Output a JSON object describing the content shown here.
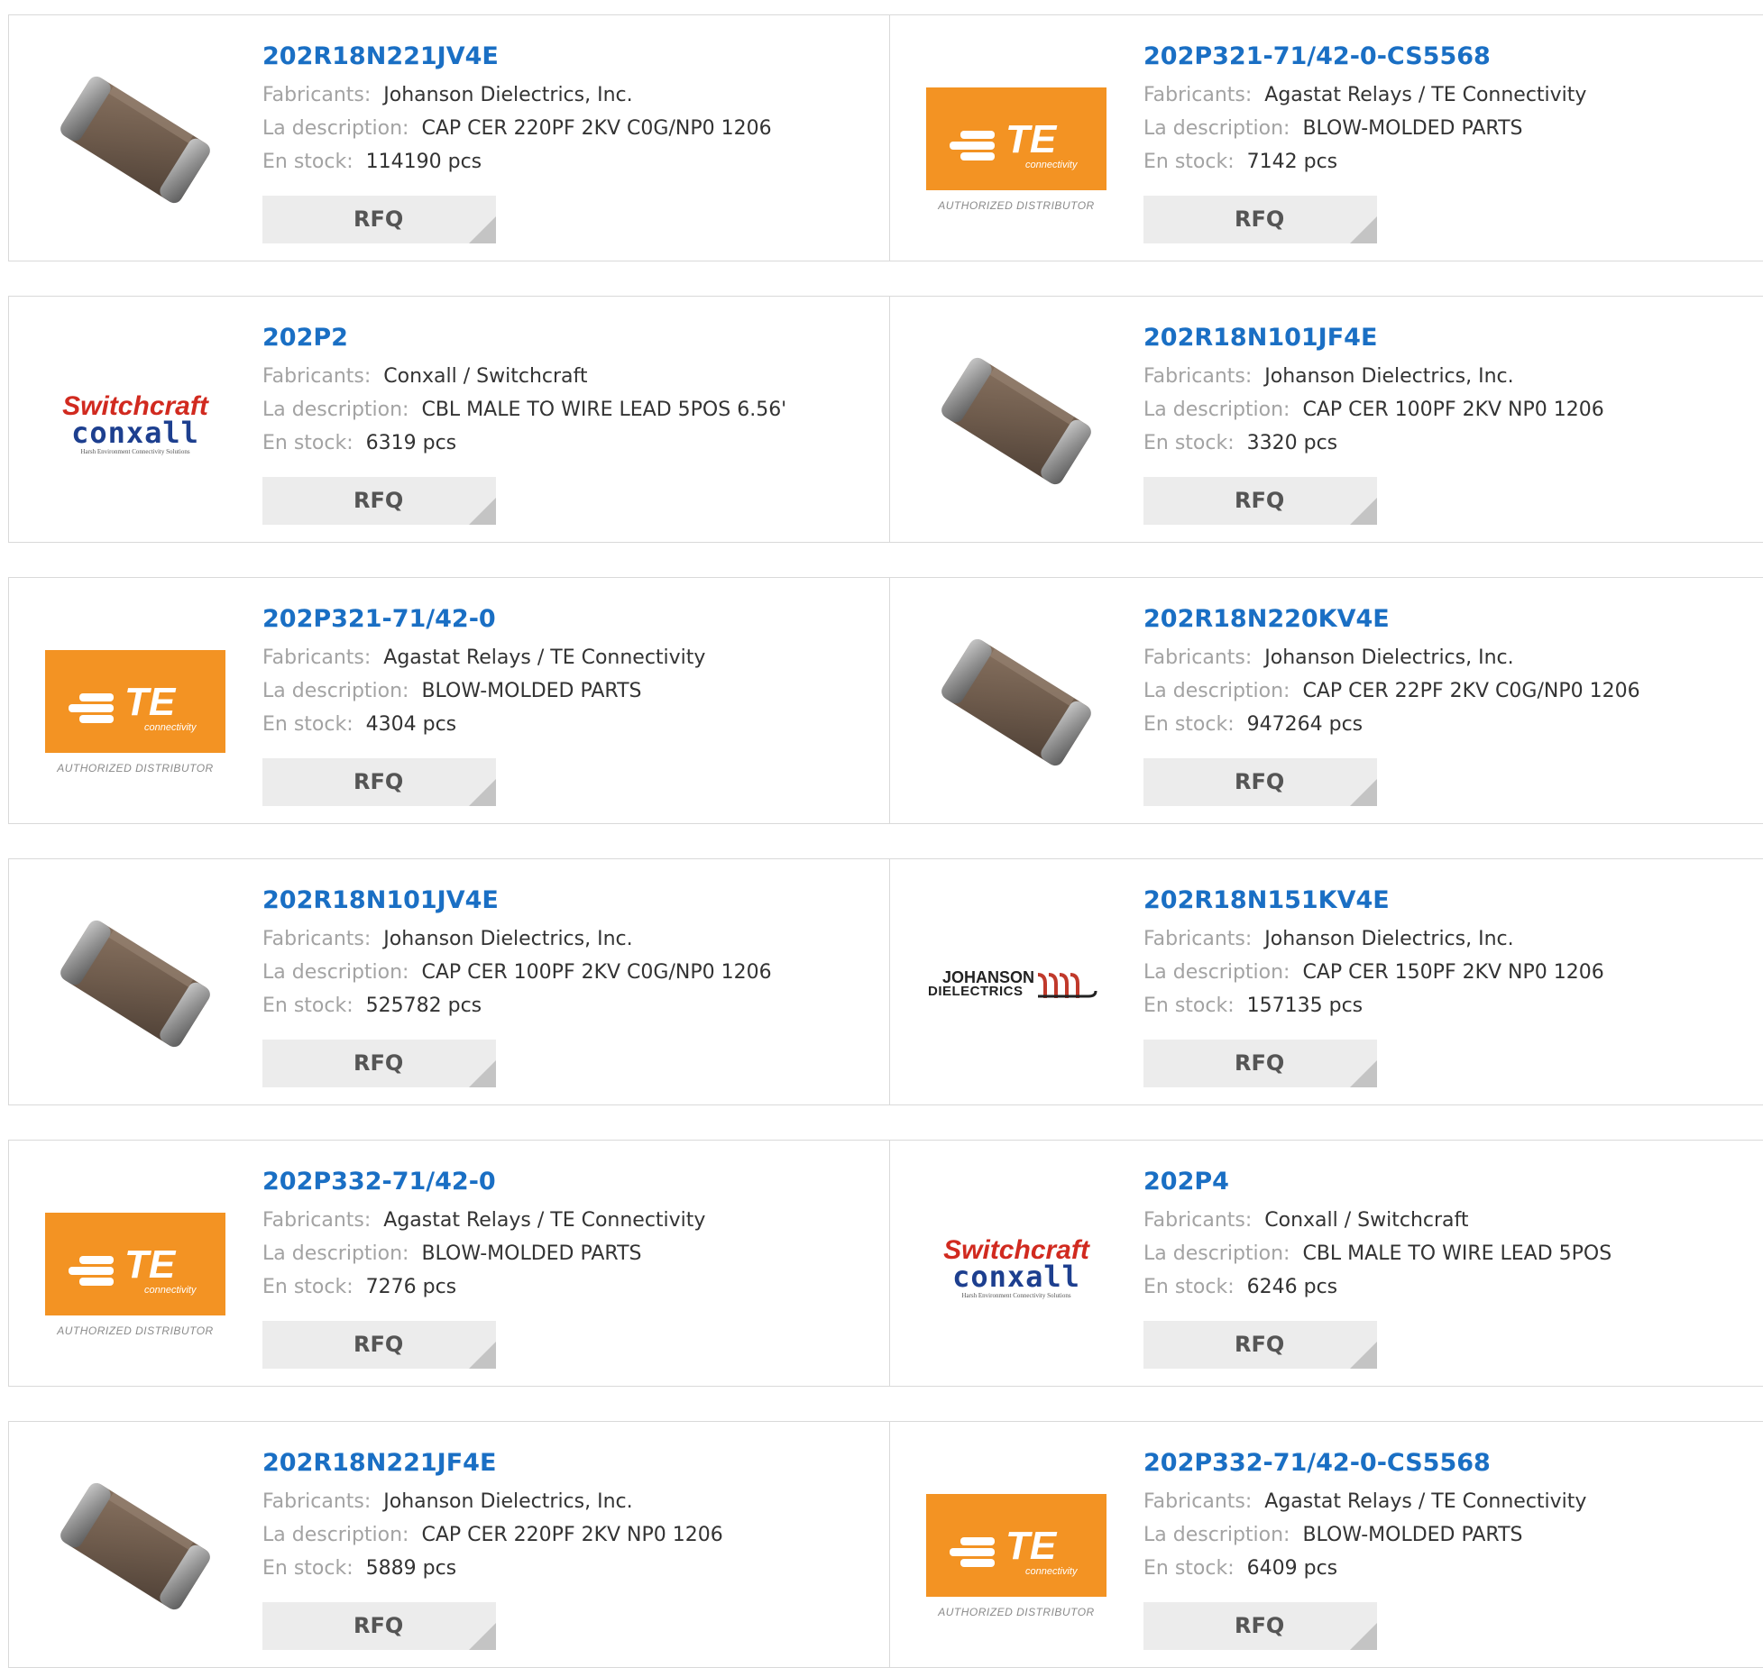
{
  "labels": {
    "manufacturer": "Fabricants:",
    "description": "La description:",
    "stock": "En stock:",
    "rfq": "RFQ",
    "te_authorized": "AUTHORIZED DISTRIBUTOR",
    "te_logo": "TE",
    "te_sub": "connectivity",
    "sw_top": "Switchcraft",
    "sw_bottom": "conxall",
    "sw_tag": "Harsh Environment Connectivity Solutions",
    "jo_top": "JOHANSON",
    "jo_bottom": "DIELECTRICS"
  },
  "colors": {
    "link": "#1a6fc4",
    "te_orange": "#f39323",
    "sw_red": "#d12a1f",
    "cx_blue": "#1d3f8f"
  },
  "rows": [
    [
      {
        "part": "202R18N221JV4E",
        "manufacturer": "Johanson Dielectrics, Inc.",
        "description": "CAP CER 220PF 2KV C0G/NP0 1206",
        "stock": "114190 pcs",
        "image": "chip-capacitor"
      },
      {
        "part": "202P321-71/42-0-CS5568",
        "manufacturer": "Agastat Relays / TE Connectivity",
        "description": "BLOW-MOLDED PARTS",
        "stock": "7142 pcs",
        "image": "te-logo"
      }
    ],
    [
      {
        "part": "202P2",
        "manufacturer": "Conxall / Switchcraft",
        "description": "CBL MALE TO WIRE LEAD 5POS 6.56'",
        "stock": "6319 pcs",
        "image": "switchcraft-logo"
      },
      {
        "part": "202R18N101JF4E",
        "manufacturer": "Johanson Dielectrics, Inc.",
        "description": "CAP CER 100PF 2KV NP0 1206",
        "stock": "3320 pcs",
        "image": "chip-capacitor"
      }
    ],
    [
      {
        "part": "202P321-71/42-0",
        "manufacturer": "Agastat Relays / TE Connectivity",
        "description": "BLOW-MOLDED PARTS",
        "stock": "4304 pcs",
        "image": "te-logo"
      },
      {
        "part": "202R18N220KV4E",
        "manufacturer": "Johanson Dielectrics, Inc.",
        "description": "CAP CER 22PF 2KV C0G/NP0 1206",
        "stock": "947264 pcs",
        "image": "chip-capacitor"
      }
    ],
    [
      {
        "part": "202R18N101JV4E",
        "manufacturer": "Johanson Dielectrics, Inc.",
        "description": "CAP CER 100PF 2KV C0G/NP0 1206",
        "stock": "525782 pcs",
        "image": "chip-capacitor"
      },
      {
        "part": "202R18N151KV4E",
        "manufacturer": "Johanson Dielectrics, Inc.",
        "description": "CAP CER 150PF 2KV NP0 1206",
        "stock": "157135 pcs",
        "image": "johanson-logo"
      }
    ],
    [
      {
        "part": "202P332-71/42-0",
        "manufacturer": "Agastat Relays / TE Connectivity",
        "description": "BLOW-MOLDED PARTS",
        "stock": "7276 pcs",
        "image": "te-logo"
      },
      {
        "part": "202P4",
        "manufacturer": "Conxall / Switchcraft",
        "description": "CBL MALE TO WIRE LEAD 5POS",
        "stock": "6246 pcs",
        "image": "switchcraft-logo"
      }
    ],
    [
      {
        "part": "202R18N221JF4E",
        "manufacturer": "Johanson Dielectrics, Inc.",
        "description": "CAP CER 220PF 2KV NP0 1206",
        "stock": "5889 pcs",
        "image": "chip-capacitor"
      },
      {
        "part": "202P332-71/42-0-CS5568",
        "manufacturer": "Agastat Relays / TE Connectivity",
        "description": "BLOW-MOLDED PARTS",
        "stock": "6409 pcs",
        "image": "te-logo"
      }
    ]
  ]
}
